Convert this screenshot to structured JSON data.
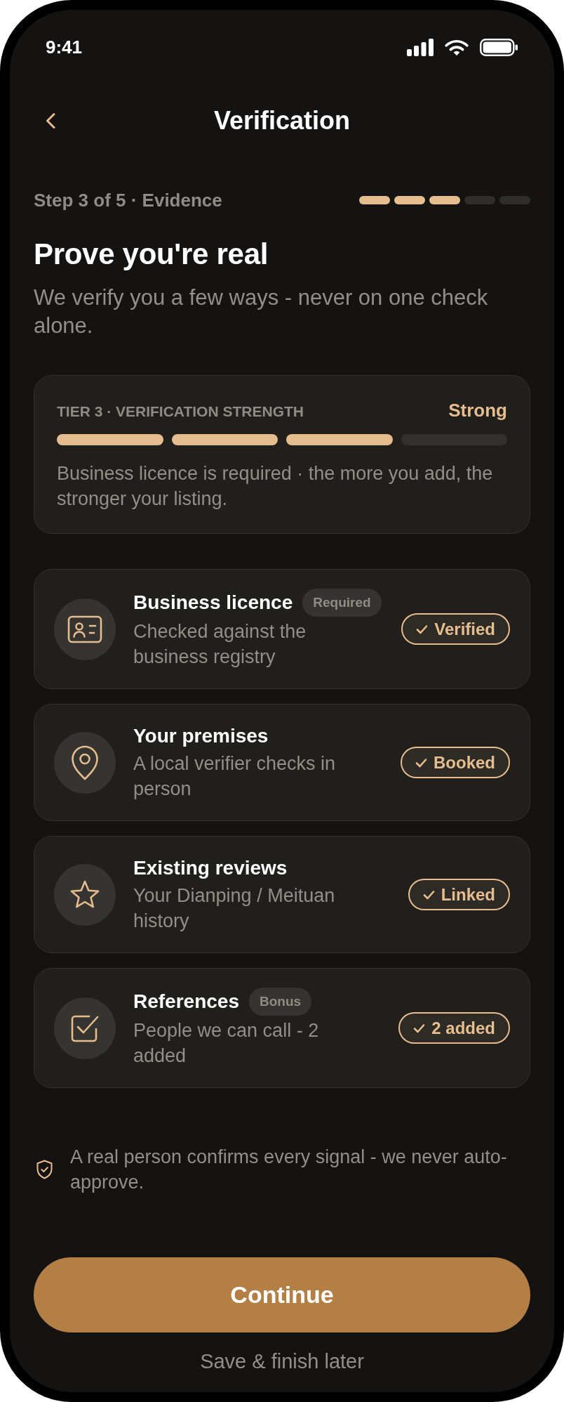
{
  "status_bar": {
    "time": "9:41"
  },
  "nav": {
    "title": "Verification"
  },
  "progress": {
    "label": "Step 3 of 5 · Evidence",
    "steps": [
      {
        "complete": true
      },
      {
        "complete": true
      },
      {
        "complete": true
      },
      {
        "complete": false
      },
      {
        "complete": false
      }
    ]
  },
  "intro": {
    "heading": "Prove you're real",
    "subtitle": "We verify you a few ways - never on one check alone."
  },
  "strength": {
    "label": "TIER 3 · VERIFICATION STRENGTH",
    "rating": "Strong",
    "segments": [
      {
        "filled": true
      },
      {
        "filled": true
      },
      {
        "filled": true
      },
      {
        "filled": false
      }
    ],
    "note": "Business licence is required · the more you add, the stronger your listing."
  },
  "evidence": [
    {
      "kind": "licence",
      "title": "Business licence",
      "tag": "Required",
      "description": "Checked against the business registry",
      "status": "Verified",
      "done": true
    },
    {
      "kind": "premises",
      "title": "Your premises",
      "description": "A local verifier checks in person",
      "status": "Booked",
      "done": true
    },
    {
      "kind": "reviews",
      "title": "Existing reviews",
      "description": "Your Dianping / Meituan history",
      "status": "Linked",
      "done": true
    },
    {
      "kind": "references",
      "title": "References",
      "tag": "Bonus",
      "description": "People we can call - 2 added",
      "status": "2 added",
      "done": true
    }
  ],
  "footer": {
    "note": "A real person confirms every signal - we never auto-approve."
  },
  "actions": {
    "primary": "Continue",
    "secondary": "Save & finish later"
  }
}
